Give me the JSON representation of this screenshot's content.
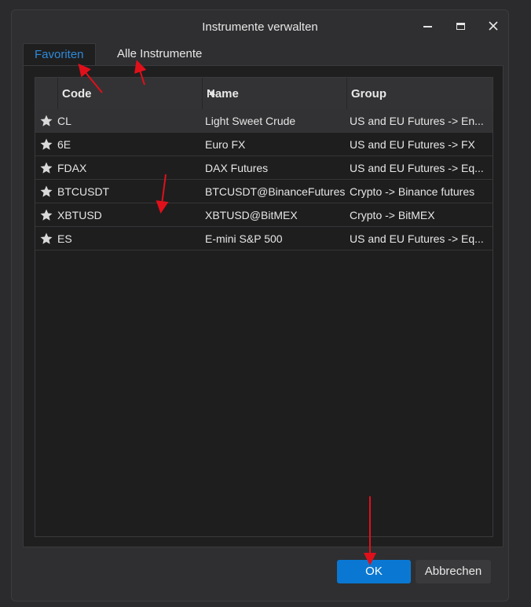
{
  "dialog": {
    "title": "Instrumente verwalten"
  },
  "tabs": [
    {
      "label": "Favoriten",
      "active": true
    },
    {
      "label": "Alle Instrumente",
      "active": false
    }
  ],
  "table": {
    "columns": [
      "Code",
      "Name",
      "Group"
    ],
    "sort_column": "Code",
    "sort_direction": "ascending",
    "rows": [
      {
        "code": "CL",
        "name": "Light Sweet Crude",
        "group": "US and EU Futures -> En...",
        "selected": true
      },
      {
        "code": "6E",
        "name": "Euro FX",
        "group": "US and EU Futures -> FX"
      },
      {
        "code": "FDAX",
        "name": "DAX Futures",
        "group": "US and EU Futures -> Eq..."
      },
      {
        "code": "BTCUSDT",
        "name": "BTCUSDT@BinanceFutures",
        "group": "Crypto -> Binance futures"
      },
      {
        "code": "XBTUSD",
        "name": "XBTUSD@BitMEX",
        "group": "Crypto -> BitMEX"
      },
      {
        "code": "ES",
        "name": "E-mini S&P 500",
        "group": "US and EU Futures -> Eq..."
      }
    ]
  },
  "buttons": {
    "ok_label": "OK",
    "cancel_label": "Abbrechen"
  },
  "icons": {
    "row_marker": "star-icon",
    "sort": "sort-ascending-icon",
    "window_controls": [
      "minimize-icon",
      "maximize-icon",
      "close-icon"
    ]
  },
  "colors": {
    "accent": "#0a78d2",
    "active_tab_text": "#2e8ad8",
    "annotation_arrow": "#e0101a",
    "background": "#2b2b2d"
  }
}
